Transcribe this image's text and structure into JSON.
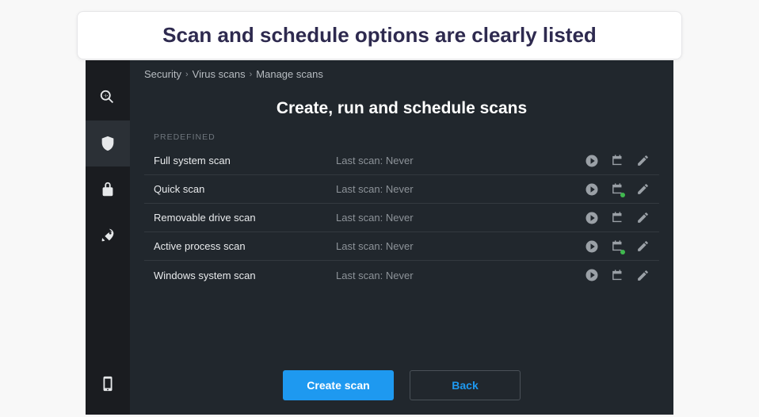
{
  "caption": "Scan and schedule options are clearly listed",
  "breadcrumb": {
    "items": [
      "Security",
      "Virus scans",
      "Manage scans"
    ]
  },
  "title": "Create, run and schedule scans",
  "section_label": "PREDEFINED",
  "scans": [
    {
      "name": "Full system scan",
      "status": "Last scan: Never",
      "scheduled": false
    },
    {
      "name": "Quick scan",
      "status": "Last scan: Never",
      "scheduled": true
    },
    {
      "name": "Removable drive scan",
      "status": "Last scan: Never",
      "scheduled": false
    },
    {
      "name": "Active process scan",
      "status": "Last scan: Never",
      "scheduled": true
    },
    {
      "name": "Windows system scan",
      "status": "Last scan: Never",
      "scheduled": false
    }
  ],
  "buttons": {
    "primary": "Create scan",
    "secondary": "Back"
  },
  "sidebar": {
    "items": [
      "search",
      "shield",
      "lock",
      "rocket"
    ],
    "bottom": "phone"
  }
}
